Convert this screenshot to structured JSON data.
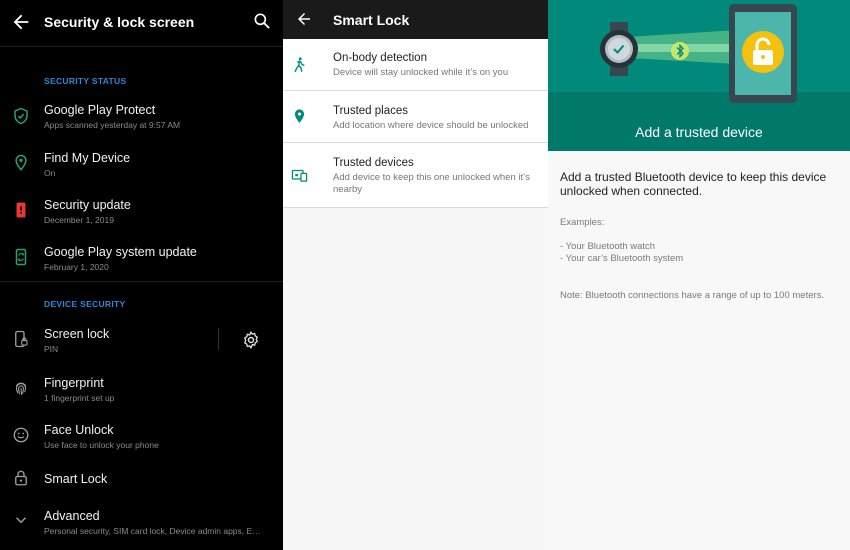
{
  "security_screen": {
    "title": "Security & lock screen",
    "section_status": "SECURITY STATUS",
    "section_device": "DEVICE SECURITY",
    "items": [
      {
        "label": "Google Play Protect",
        "sub": "Apps scanned yesterday at 9:57 AM",
        "icon": "shield-check-icon"
      },
      {
        "label": "Find My Device",
        "sub": "On",
        "icon": "location-pin-icon"
      },
      {
        "label": "Security update",
        "sub": "December 1, 2019",
        "icon": "phone-alert-icon"
      },
      {
        "label": "Google Play system update",
        "sub": "February 1, 2020",
        "icon": "phone-sync-icon"
      },
      {
        "label": "Screen lock",
        "sub": "PIN",
        "icon": "phone-lock-icon"
      },
      {
        "label": "Fingerprint",
        "sub": "1 fingerprint set up",
        "icon": "fingerprint-icon"
      },
      {
        "label": "Face Unlock",
        "sub": "Use face to unlock your phone",
        "icon": "face-icon"
      },
      {
        "label": "Smart Lock",
        "sub": "",
        "icon": "padlock-icon"
      },
      {
        "label": "Advanced",
        "sub": "Personal security, SIM card lock, Device admin apps, E…",
        "icon": "chevron-down-icon"
      }
    ]
  },
  "smart_lock": {
    "title": "Smart Lock",
    "items": [
      {
        "label": "On-body detection",
        "sub": "Device will stay unlocked while it’s on you",
        "icon": "walking-person-icon"
      },
      {
        "label": "Trusted places",
        "sub": "Add location where device should be unlocked",
        "icon": "location-pin-icon"
      },
      {
        "label": "Trusted devices",
        "sub": "Add device to keep this one unlocked when it’s nearby",
        "icon": "devices-icon"
      }
    ]
  },
  "trusted_device": {
    "hero_title": "Add a trusted device",
    "lead": "Add a trusted Bluetooth device to keep this device unlocked when connected.",
    "examples_heading": "Examples:",
    "example_1": "- Your Bluetooth watch",
    "example_2": "- Your car’s Bluetooth system",
    "note": "Note: Bluetooth connections have a range of up to 100 meters."
  },
  "colors": {
    "accent_blue": "#2d87d9",
    "icon_green": "#27a36a",
    "alert_red": "#e53935",
    "teal": "#01897b",
    "lock_yellow": "#f4c20d"
  }
}
